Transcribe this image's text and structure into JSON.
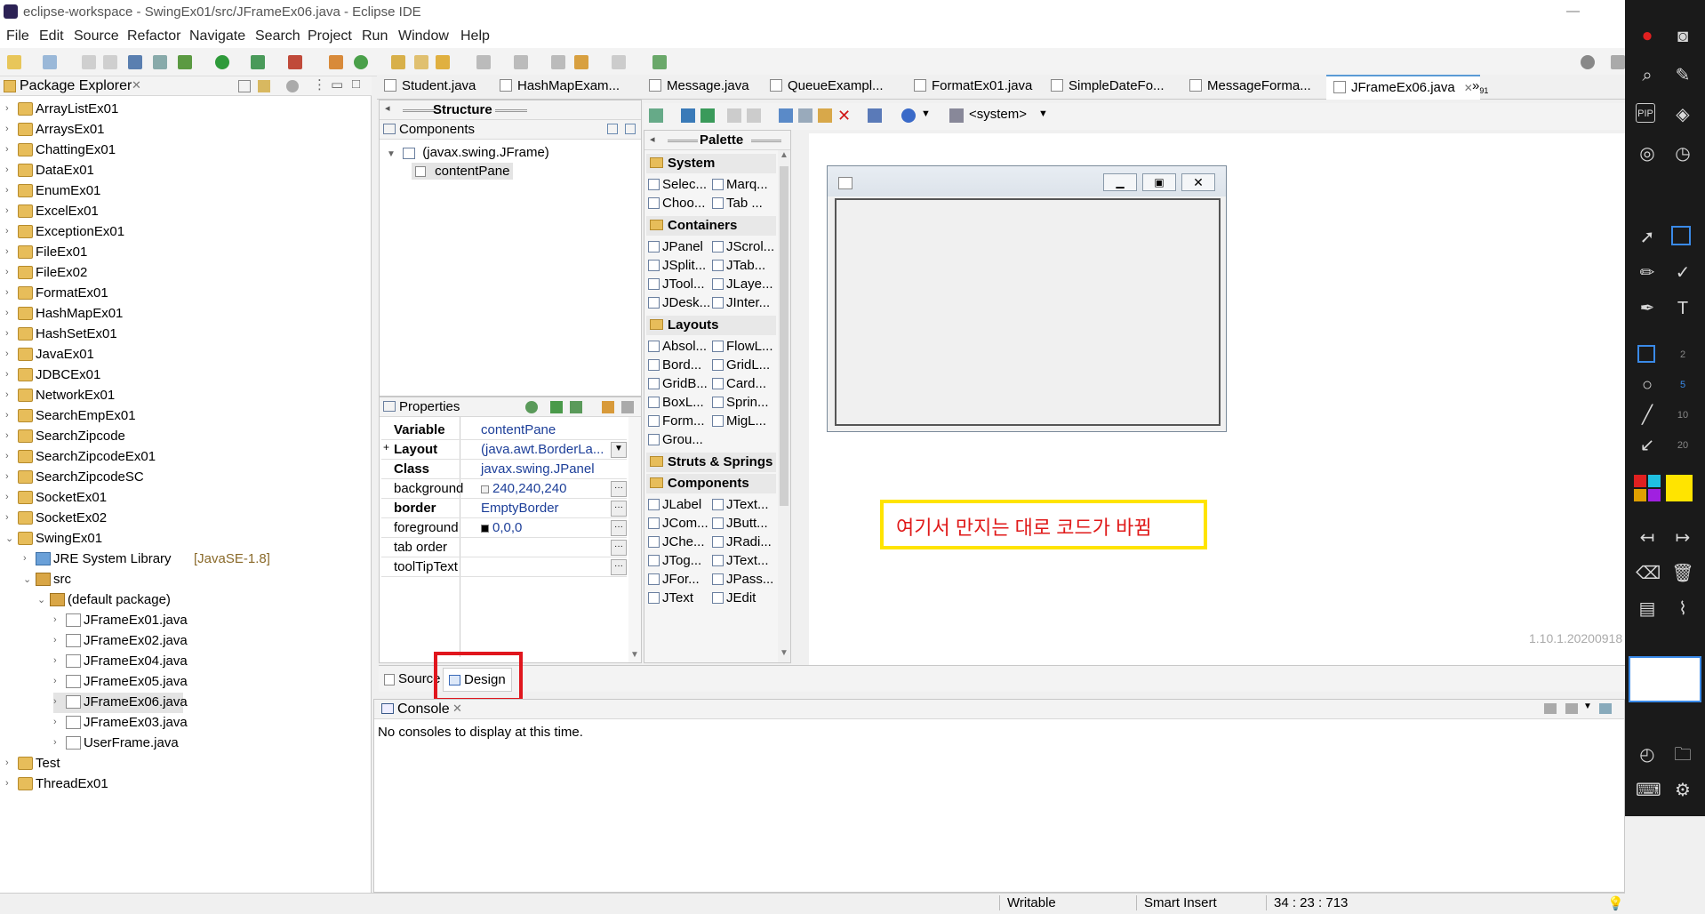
{
  "window": {
    "title": "eclipse-workspace - SwingEx01/src/JFrameEx06.java - Eclipse IDE"
  },
  "menu": [
    "File",
    "Edit",
    "Source",
    "Refactor",
    "Navigate",
    "Search",
    "Project",
    "Run",
    "Window",
    "Help"
  ],
  "package_explorer": {
    "title": "Package Explorer",
    "items": [
      {
        "label": "ArrayListEx01"
      },
      {
        "label": "ArraysEx01"
      },
      {
        "label": "ChattingEx01"
      },
      {
        "label": "DataEx01"
      },
      {
        "label": "EnumEx01"
      },
      {
        "label": "ExcelEx01"
      },
      {
        "label": "ExceptionEx01"
      },
      {
        "label": "FileEx01"
      },
      {
        "label": "FileEx02"
      },
      {
        "label": "FormatEx01"
      },
      {
        "label": "HashMapEx01"
      },
      {
        "label": "HashSetEx01"
      },
      {
        "label": "JavaEx01"
      },
      {
        "label": "JDBCEx01"
      },
      {
        "label": "NetworkEx01"
      },
      {
        "label": "SearchEmpEx01"
      },
      {
        "label": "SearchZipcode"
      },
      {
        "label": "SearchZipcodeEx01"
      },
      {
        "label": "SearchZipcodeSC"
      },
      {
        "label": "SocketEx01"
      },
      {
        "label": "SocketEx02"
      },
      {
        "label": "SwingEx01"
      }
    ],
    "jre": "JRE System Library",
    "jre_version": "[JavaSE-1.8]",
    "src": "src",
    "default_package": "(default package)",
    "files": [
      "JFrameEx01.java",
      "JFrameEx02.java",
      "JFrameEx04.java",
      "JFrameEx05.java",
      "JFrameEx06.java",
      "JFrameEx03.java",
      "UserFrame.java"
    ],
    "after": [
      {
        "label": "Test"
      },
      {
        "label": "ThreadEx01"
      }
    ]
  },
  "editor_tabs": [
    "Student.java",
    "HashMapExam...",
    "Message.java",
    "QueueExampl...",
    "FormatEx01.java",
    "SimpleDateFo...",
    "MessageForma...",
    "JFrameEx06.java"
  ],
  "editor_tabs_overflow": "»",
  "editor_tabs_overflow_count": "91",
  "structure": {
    "title": "Structure",
    "components_label": "Components",
    "root": "(javax.swing.JFrame)",
    "child": "contentPane"
  },
  "properties": {
    "title": "Properties",
    "rows": [
      {
        "key": "Variable",
        "value": "contentPane"
      },
      {
        "key": "Layout",
        "value": "(java.awt.BorderLa..."
      },
      {
        "key": "Class",
        "value": "javax.swing.JPanel"
      },
      {
        "key": "background",
        "value": "240,240,240"
      },
      {
        "key": "border",
        "value": "EmptyBorder"
      },
      {
        "key": "foreground",
        "value": "0,0,0"
      },
      {
        "key": "tab order",
        "value": ""
      },
      {
        "key": "toolTipText",
        "value": ""
      }
    ]
  },
  "toolbar_design": {
    "system_label": "<system>"
  },
  "palette": {
    "title": "Palette",
    "categories": [
      {
        "name": "System",
        "items": [
          "Selec...",
          "Marq...",
          "Choo...",
          "Tab ..."
        ]
      },
      {
        "name": "Containers",
        "items": [
          "JPanel",
          "JScrol...",
          "JSplit...",
          "JTab...",
          "JTool...",
          "JLaye...",
          "JDesk...",
          "JInter..."
        ]
      },
      {
        "name": "Layouts",
        "items": [
          "Absol...",
          "FlowL...",
          "Bord...",
          "GridL...",
          "GridB...",
          "Card...",
          "BoxL...",
          "Sprin...",
          "Form...",
          "MigL...",
          "Grou..."
        ]
      },
      {
        "name": "Struts & Springs",
        "items": []
      },
      {
        "name": "Components",
        "items": [
          "JLabel",
          "JText...",
          "JCom...",
          "JButt...",
          "JChe...",
          "JRadi...",
          "JTog...",
          "JText...",
          "JFor...",
          "JPass...",
          "JText",
          "JEdit"
        ]
      }
    ]
  },
  "canvas": {
    "note": "여기서 만지는 대로 코드가 바뀜",
    "version": "1.10.1.20200918"
  },
  "bottom_tabs": {
    "source": "Source",
    "design": "Design"
  },
  "console": {
    "title": "Console",
    "message": "No consoles to display at this time."
  },
  "status": {
    "writable": "Writable",
    "insert": "Smart Insert",
    "position": "34 : 23 : 713"
  },
  "colors": {
    "note_border": "#ffe400",
    "note_text": "#e01a1a",
    "highlight_box": "#e0161d"
  }
}
